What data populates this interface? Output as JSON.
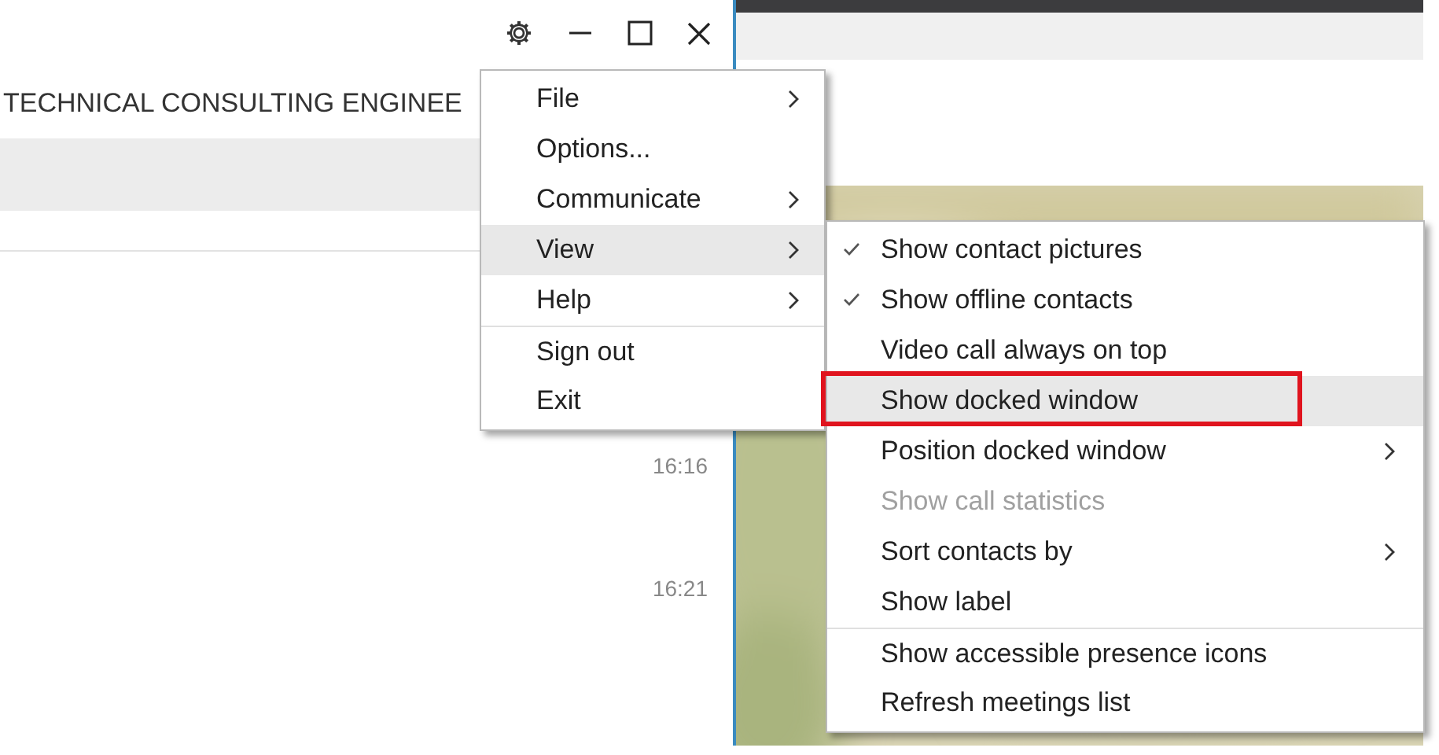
{
  "app_window": {
    "title": "TECHNICAL CONSULTING ENGINEE",
    "times": [
      "16:16",
      "16:21"
    ]
  },
  "main_menu": [
    {
      "label": "File",
      "submenu": true,
      "selected": false,
      "separator_before": false
    },
    {
      "label": "Options...",
      "submenu": false,
      "selected": false,
      "separator_before": false
    },
    {
      "label": "Communicate",
      "submenu": true,
      "selected": false,
      "separator_before": false
    },
    {
      "label": "View",
      "submenu": true,
      "selected": true,
      "separator_before": false
    },
    {
      "label": "Help",
      "submenu": true,
      "selected": false,
      "separator_before": false
    },
    {
      "label": "Sign out",
      "submenu": false,
      "selected": false,
      "separator_before": true
    },
    {
      "label": "Exit",
      "submenu": false,
      "selected": false,
      "separator_before": false
    }
  ],
  "view_submenu": [
    {
      "label": "Show contact pictures",
      "checked": true,
      "submenu": false,
      "disabled": false,
      "selected": false,
      "annotated": false,
      "separator_before": false
    },
    {
      "label": "Show offline contacts",
      "checked": true,
      "submenu": false,
      "disabled": false,
      "selected": false,
      "annotated": false,
      "separator_before": false
    },
    {
      "label": "Video call always on top",
      "checked": false,
      "submenu": false,
      "disabled": false,
      "selected": false,
      "annotated": false,
      "separator_before": false
    },
    {
      "label": "Show docked window",
      "checked": false,
      "submenu": false,
      "disabled": false,
      "selected": true,
      "annotated": true,
      "separator_before": false
    },
    {
      "label": "Position docked window",
      "checked": false,
      "submenu": true,
      "disabled": false,
      "selected": false,
      "annotated": false,
      "separator_before": false
    },
    {
      "label": "Show call statistics",
      "checked": false,
      "submenu": false,
      "disabled": true,
      "selected": false,
      "annotated": false,
      "separator_before": false
    },
    {
      "label": "Sort contacts by",
      "checked": false,
      "submenu": true,
      "disabled": false,
      "selected": false,
      "annotated": false,
      "separator_before": false
    },
    {
      "label": "Show label",
      "checked": false,
      "submenu": false,
      "disabled": false,
      "selected": false,
      "annotated": false,
      "separator_before": false
    },
    {
      "label": "Show accessible presence icons",
      "checked": false,
      "submenu": false,
      "disabled": false,
      "selected": false,
      "annotated": false,
      "separator_before": true
    },
    {
      "label": "Refresh meetings list",
      "checked": false,
      "submenu": false,
      "disabled": false,
      "selected": false,
      "annotated": false,
      "separator_before": false
    }
  ]
}
